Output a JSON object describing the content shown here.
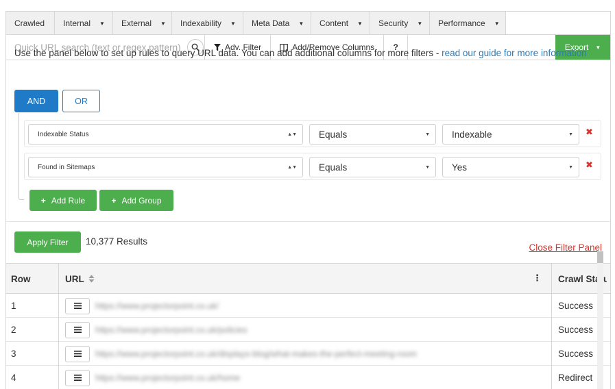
{
  "nav": {
    "tabs": [
      {
        "label": "Crawled",
        "has_caret": false
      },
      {
        "label": "Internal",
        "has_caret": true
      },
      {
        "label": "External",
        "has_caret": true
      },
      {
        "label": "Indexability",
        "has_caret": true
      },
      {
        "label": "Meta Data",
        "has_caret": true
      },
      {
        "label": "Content",
        "has_caret": true
      },
      {
        "label": "Security",
        "has_caret": true
      },
      {
        "label": "Performance",
        "has_caret": true
      }
    ]
  },
  "toolbar": {
    "search_placeholder": "Quick URL search (text or regex pattern)",
    "adv_filter_label": "Adv. Filter",
    "columns_label": "Add/Remove Columns",
    "help_label": "?",
    "export_label": "Export"
  },
  "filter_panel": {
    "intro_text": "Use the panel below to set up rules to query URL data. You can add additional columns for more filters - ",
    "guide_link": "read our guide for more information",
    "and_label": "AND",
    "or_label": "OR",
    "rules": [
      {
        "field": "Indexable Status",
        "operator": "Equals",
        "value": "Indexable"
      },
      {
        "field": "Found in Sitemaps",
        "operator": "Equals",
        "value": "Yes"
      }
    ],
    "add_rule_label": "Add Rule",
    "add_group_label": "Add Group"
  },
  "apply": {
    "button_label": "Apply Filter",
    "results_text": "10,377 Results",
    "close_label": "Close Filter Panel"
  },
  "table": {
    "columns": {
      "row": "Row",
      "url": "URL",
      "status": "Crawl Status"
    },
    "rows": [
      {
        "row": "1",
        "url": "https://www.projectorpoint.co.uk/",
        "status": "Success"
      },
      {
        "row": "2",
        "url": "https://www.projectorpoint.co.uk/policies",
        "status": "Success"
      },
      {
        "row": "3",
        "url": "https://www.projectorpoint.co.uk/displays-blog/what-makes-the-perfect-meeting-room",
        "status": "Success"
      },
      {
        "row": "4",
        "url": "https://www.projectorpoint.co.uk/home",
        "status": "Redirect"
      }
    ]
  },
  "colors": {
    "primary": "#1f7bc7",
    "success": "#4cae4c",
    "danger": "#d9342b",
    "link": "#2a7ab8"
  }
}
